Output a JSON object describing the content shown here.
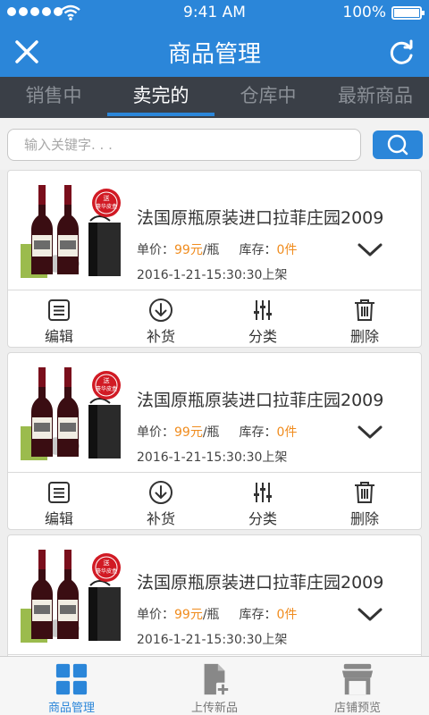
{
  "status_bar": {
    "time": "9:41 AM",
    "battery": "100%"
  },
  "header": {
    "title": "商品管理",
    "close_icon": "close-icon",
    "refresh_icon": "refresh-icon"
  },
  "tabs": [
    {
      "label": "销售中",
      "active": false
    },
    {
      "label": "卖完的",
      "active": true
    },
    {
      "label": "仓库中",
      "active": false
    },
    {
      "label": "最新商品",
      "active": false
    }
  ],
  "search": {
    "placeholder": "输入关键字. . .",
    "value": ""
  },
  "products": [
    {
      "name": "法国原瓶原装进口拉菲庄园2009",
      "price_label": "单价：",
      "price": "99元",
      "price_unit": "/瓶",
      "stock_label": "库存：",
      "stock": "0件",
      "date": "2016-1-21-15:30:30上架",
      "promo_badge": [
        "送",
        "豪华皮盒"
      ]
    },
    {
      "name": "法国原瓶原装进口拉菲庄园2009",
      "price_label": "单价：",
      "price": "99元",
      "price_unit": "/瓶",
      "stock_label": "库存：",
      "stock": "0件",
      "date": "2016-1-21-15:30:30上架",
      "promo_badge": [
        "送",
        "豪华皮盒"
      ]
    },
    {
      "name": "法国原瓶原装进口拉菲庄园2009",
      "price_label": "单价：",
      "price": "99元",
      "price_unit": "/瓶",
      "stock_label": "库存：",
      "stock": "0件",
      "date": "2016-1-21-15:30:30上架",
      "promo_badge": [
        "送",
        "豪华皮盒"
      ]
    }
  ],
  "actions": [
    {
      "label": "编辑",
      "icon": "edit-icon"
    },
    {
      "label": "补货",
      "icon": "restock-icon"
    },
    {
      "label": "分类",
      "icon": "category-icon"
    },
    {
      "label": "删除",
      "icon": "trash-icon"
    }
  ],
  "bottom_nav": [
    {
      "label": "商品管理",
      "icon": "grid-icon",
      "active": true
    },
    {
      "label": "上传新品",
      "icon": "upload-file-icon",
      "active": false
    },
    {
      "label": "店铺预览",
      "icon": "store-icon",
      "active": false
    }
  ],
  "colors": {
    "primary": "#2b86d9",
    "tab_bar": "#3a3f47",
    "accent_orange": "#f08c1e"
  }
}
